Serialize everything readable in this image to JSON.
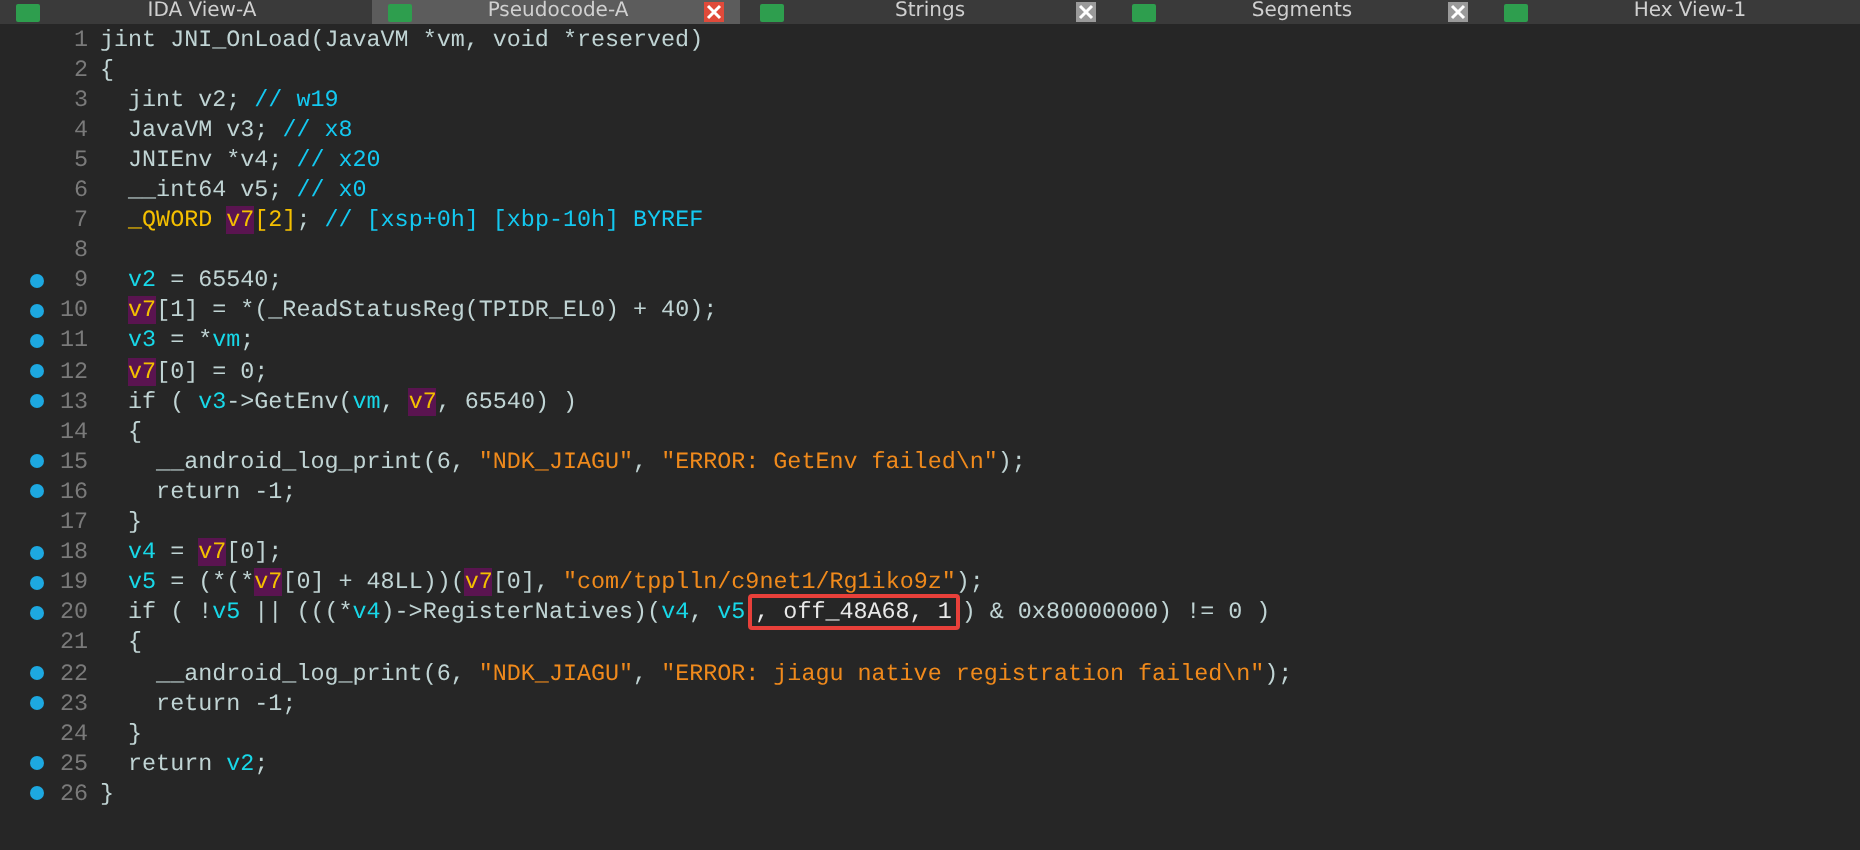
{
  "tabs": [
    {
      "label": "IDA View-A",
      "selected": false,
      "closable": false
    },
    {
      "label": "Pseudocode-A",
      "selected": true,
      "closable": true
    },
    {
      "label": "Strings",
      "selected": false,
      "closable": true
    },
    {
      "label": "Segments",
      "selected": false,
      "closable": true
    },
    {
      "label": "Hex View-1",
      "selected": false,
      "closable": false
    }
  ],
  "code": {
    "lines": [
      {
        "number": "1",
        "breakpoint": false,
        "segments": [
          {
            "kind": "t",
            "text": "jint JNI_OnLoad(JavaVM *vm, void *reserved)"
          }
        ]
      },
      {
        "number": "2",
        "breakpoint": false,
        "segments": [
          {
            "kind": "t",
            "text": "{"
          }
        ]
      },
      {
        "number": "3",
        "breakpoint": false,
        "segments": [
          {
            "kind": "t",
            "text": "  jint v2; "
          },
          {
            "kind": "c",
            "text": "// w19"
          }
        ]
      },
      {
        "number": "4",
        "breakpoint": false,
        "segments": [
          {
            "kind": "t",
            "text": "  JavaVM v3; "
          },
          {
            "kind": "c",
            "text": "// x8"
          }
        ]
      },
      {
        "number": "5",
        "breakpoint": false,
        "segments": [
          {
            "kind": "t",
            "text": "  JNIEnv *v4; "
          },
          {
            "kind": "c",
            "text": "// x20"
          }
        ]
      },
      {
        "number": "6",
        "breakpoint": false,
        "segments": [
          {
            "kind": "t",
            "text": "  __int64 v5; "
          },
          {
            "kind": "c",
            "text": "// x0"
          }
        ]
      },
      {
        "number": "7",
        "breakpoint": false,
        "segments": [
          {
            "kind": "y",
            "text": "  _QWORD "
          },
          {
            "kind": "h",
            "text": "v7"
          },
          {
            "kind": "y",
            "text": "[2]"
          },
          {
            "kind": "t",
            "text": "; "
          },
          {
            "kind": "c",
            "text": "// [xsp+0h] [xbp-10h] BYREF"
          }
        ]
      },
      {
        "number": "8",
        "breakpoint": false
      },
      {
        "number": "9",
        "breakpoint": true,
        "segments": [
          {
            "kind": "v",
            "text": "  v2"
          },
          {
            "kind": "t",
            "text": " = 65540;"
          }
        ]
      },
      {
        "number": "10",
        "breakpoint": true,
        "segments": [
          {
            "kind": "h",
            "text": "  v7"
          },
          {
            "kind": "t",
            "text": "[1] = *(_ReadStatusReg(TPIDR_EL0) + 40);"
          }
        ]
      },
      {
        "number": "11",
        "breakpoint": true,
        "segments": [
          {
            "kind": "v",
            "text": "  v3"
          },
          {
            "kind": "t",
            "text": " = *"
          },
          {
            "kind": "v",
            "text": "vm"
          },
          {
            "kind": "t",
            "text": ";"
          }
        ]
      },
      {
        "number": "12",
        "breakpoint": true,
        "segments": [
          {
            "kind": "h",
            "text": "  v7"
          },
          {
            "kind": "t",
            "text": "[0] = 0;"
          }
        ]
      },
      {
        "number": "13",
        "breakpoint": true,
        "segments": [
          {
            "kind": "t",
            "text": "  if ( "
          },
          {
            "kind": "v",
            "text": "v3"
          },
          {
            "kind": "t",
            "text": "->GetEnv("
          },
          {
            "kind": "v",
            "text": "vm"
          },
          {
            "kind": "t",
            "text": ", "
          },
          {
            "kind": "h",
            "text": "v7"
          },
          {
            "kind": "t",
            "text": ", 65540) )"
          }
        ]
      },
      {
        "number": "14",
        "breakpoint": false,
        "segments": [
          {
            "kind": "t",
            "text": "  {"
          }
        ]
      },
      {
        "number": "15",
        "breakpoint": true,
        "segments": [
          {
            "kind": "t",
            "text": "    __android_log_print(6, "
          },
          {
            "kind": "s",
            "text": "\"NDK_JIAGU\""
          },
          {
            "kind": "t",
            "text": ", "
          },
          {
            "kind": "s",
            "text": "\"ERROR: GetEnv failed\\n\""
          },
          {
            "kind": "t",
            "text": ");"
          }
        ]
      },
      {
        "number": "16",
        "breakpoint": true,
        "segments": [
          {
            "kind": "t",
            "text": "    return -1;"
          }
        ]
      },
      {
        "number": "17",
        "breakpoint": false,
        "segments": [
          {
            "kind": "t",
            "text": "  }"
          }
        ]
      },
      {
        "number": "18",
        "breakpoint": true,
        "segments": [
          {
            "kind": "v",
            "text": "  v4"
          },
          {
            "kind": "t",
            "text": " = "
          },
          {
            "kind": "h",
            "text": "v7"
          },
          {
            "kind": "t",
            "text": "[0];"
          }
        ]
      },
      {
        "number": "19",
        "breakpoint": true,
        "segments": [
          {
            "kind": "v",
            "text": "  v5"
          },
          {
            "kind": "t",
            "text": " = (*(*"
          },
          {
            "kind": "h",
            "text": "v7"
          },
          {
            "kind": "t",
            "text": "[0] + 48LL))("
          },
          {
            "kind": "h",
            "text": "v7"
          },
          {
            "kind": "t",
            "text": "[0], "
          },
          {
            "kind": "s",
            "text": "\"com/tpplln/c9net1/Rg1iko9z\""
          },
          {
            "kind": "t",
            "text": ");"
          }
        ]
      },
      {
        "number": "20",
        "breakpoint": true,
        "segments": [
          {
            "kind": "t",
            "text": "  if ( !"
          },
          {
            "kind": "v",
            "text": "v5"
          },
          {
            "kind": "t",
            "text": " || (((*"
          },
          {
            "kind": "v",
            "text": "v4"
          },
          {
            "kind": "t",
            "text": ")->RegisterNatives)("
          },
          {
            "kind": "v",
            "text": "v4"
          },
          {
            "kind": "t",
            "text": ", "
          },
          {
            "kind": "v",
            "text": "v5"
          },
          {
            "kind": "boxed",
            "text": ", off_48A68, 1"
          },
          {
            "kind": "t",
            "text": ") & 0x80000000) != 0 )"
          }
        ]
      },
      {
        "number": "21",
        "breakpoint": false,
        "segments": [
          {
            "kind": "t",
            "text": "  {"
          }
        ]
      },
      {
        "number": "22",
        "breakpoint": true,
        "segments": [
          {
            "kind": "t",
            "text": "    __android_log_print(6, "
          },
          {
            "kind": "s",
            "text": "\"NDK_JIAGU\""
          },
          {
            "kind": "t",
            "text": ", "
          },
          {
            "kind": "s",
            "text": "\"ERROR: jiagu native registration failed\\n\""
          },
          {
            "kind": "t",
            "text": ");"
          }
        ]
      },
      {
        "number": "23",
        "breakpoint": true,
        "segments": [
          {
            "kind": "t",
            "text": "    return -1;"
          }
        ]
      },
      {
        "number": "24",
        "breakpoint": false,
        "segments": [
          {
            "kind": "t",
            "text": "  }"
          }
        ]
      },
      {
        "number": "25",
        "breakpoint": true,
        "segments": [
          {
            "kind": "t",
            "text": "  return "
          },
          {
            "kind": "v",
            "text": "v2"
          },
          {
            "kind": "t",
            "text": ";"
          }
        ]
      },
      {
        "number": "26",
        "breakpoint": true,
        "segments": [
          {
            "kind": "t",
            "text": "}"
          }
        ]
      }
    ]
  }
}
